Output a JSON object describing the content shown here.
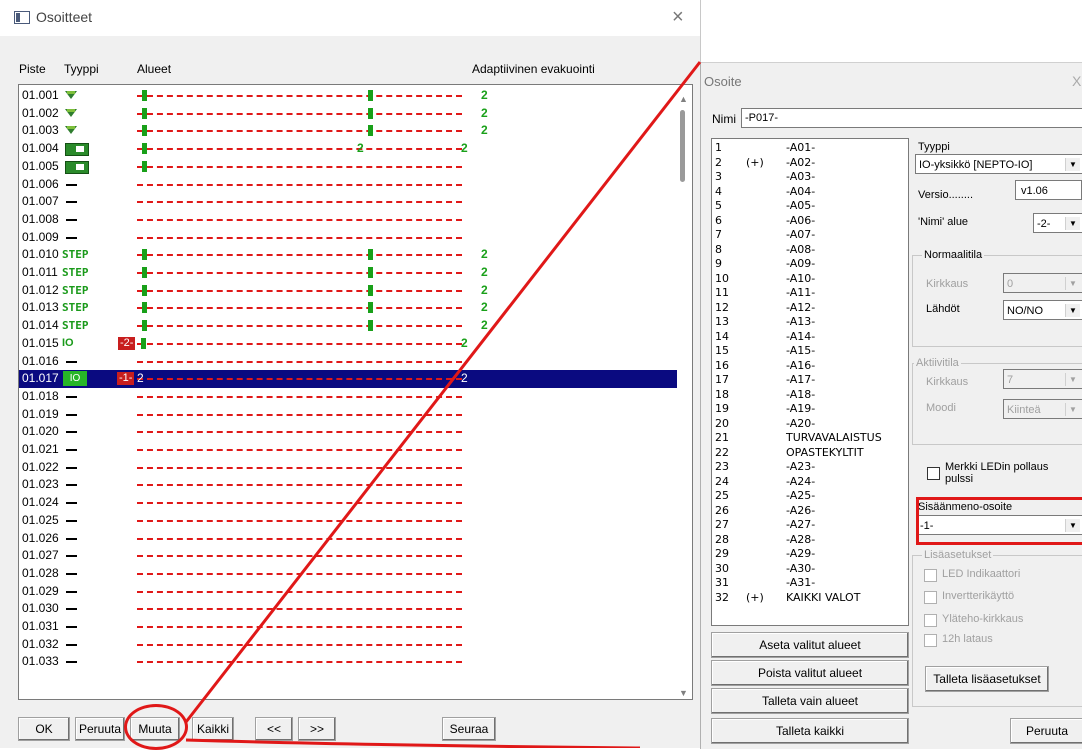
{
  "main_window": {
    "title": "Osoitteet",
    "close_symbol": "×",
    "columns": {
      "piste": "Piste",
      "tyyppi": "Tyyppi",
      "alueet": "Alueet",
      "adaptive": "Adaptiivinen evakuointi"
    },
    "rows": [
      {
        "id": "01.001",
        "type": "shield-icon",
        "areas": [
          "1",
          "1",
          "2"
        ]
      },
      {
        "id": "01.002",
        "type": "shield-icon",
        "areas": [
          "1",
          "1",
          "2"
        ]
      },
      {
        "id": "01.003",
        "type": "shield-icon",
        "areas": [
          "1",
          "1",
          "2"
        ]
      },
      {
        "id": "01.004",
        "type": "board-icon",
        "areas": [
          "1",
          "2",
          "2"
        ]
      },
      {
        "id": "01.005",
        "type": "board-icon",
        "areas": [
          "1"
        ]
      },
      {
        "id": "01.006",
        "type": "dash",
        "areas": []
      },
      {
        "id": "01.007",
        "type": "dash",
        "areas": []
      },
      {
        "id": "01.008",
        "type": "dash",
        "areas": []
      },
      {
        "id": "01.009",
        "type": "dash",
        "areas": []
      },
      {
        "id": "01.010",
        "type": "STEP",
        "areas": [
          "1",
          "1",
          "2"
        ]
      },
      {
        "id": "01.011",
        "type": "STEP",
        "areas": [
          "1",
          "1",
          "2"
        ]
      },
      {
        "id": "01.012",
        "type": "STEP",
        "areas": [
          "1",
          "1",
          "2"
        ]
      },
      {
        "id": "01.013",
        "type": "STEP",
        "areas": [
          "1",
          "1",
          "2"
        ]
      },
      {
        "id": "01.014",
        "type": "STEP",
        "areas": [
          "1",
          "1",
          "2"
        ]
      },
      {
        "id": "01.015",
        "type": "IO",
        "tag": "-2-",
        "areas": [
          "1",
          "2"
        ]
      },
      {
        "id": "01.016",
        "type": "dash",
        "areas": []
      },
      {
        "id": "01.017",
        "type": "IO-selected",
        "tag": "-1-",
        "areas": [
          "2",
          "2"
        ]
      },
      {
        "id": "01.018",
        "type": "dash",
        "areas": []
      },
      {
        "id": "01.019",
        "type": "dash",
        "areas": []
      },
      {
        "id": "01.020",
        "type": "dash",
        "areas": []
      },
      {
        "id": "01.021",
        "type": "dash",
        "areas": []
      },
      {
        "id": "01.022",
        "type": "dash",
        "areas": []
      },
      {
        "id": "01.023",
        "type": "dash",
        "areas": []
      },
      {
        "id": "01.024",
        "type": "dash",
        "areas": []
      },
      {
        "id": "01.025",
        "type": "dash",
        "areas": []
      },
      {
        "id": "01.026",
        "type": "dash",
        "areas": []
      },
      {
        "id": "01.027",
        "type": "dash",
        "areas": []
      },
      {
        "id": "01.028",
        "type": "dash",
        "areas": []
      },
      {
        "id": "01.029",
        "type": "dash",
        "areas": []
      },
      {
        "id": "01.030",
        "type": "dash",
        "areas": []
      },
      {
        "id": "01.031",
        "type": "dash",
        "areas": []
      },
      {
        "id": "01.032",
        "type": "dash",
        "areas": []
      },
      {
        "id": "01.033",
        "type": "dash",
        "areas": []
      }
    ],
    "buttons": {
      "ok": "OK",
      "peruuta": "Peruuta",
      "muuta": "Muuta",
      "kaikki": "Kaikki",
      "prev": "<<",
      "next": ">>",
      "seuraa": "Seuraa"
    },
    "step_label": "STEP",
    "io_label": "IO"
  },
  "dialog": {
    "title": "Osoite",
    "close_symbol": "X",
    "nimi_label": "Nimi",
    "nimi_value": "-P017-",
    "areas": [
      {
        "num": "1",
        "flag": "",
        "name": "-A01-"
      },
      {
        "num": "2",
        "flag": "(+)",
        "name": "-A02-"
      },
      {
        "num": "3",
        "flag": "",
        "name": "-A03-"
      },
      {
        "num": "4",
        "flag": "",
        "name": "-A04-"
      },
      {
        "num": "5",
        "flag": "",
        "name": "-A05-"
      },
      {
        "num": "6",
        "flag": "",
        "name": "-A06-"
      },
      {
        "num": "7",
        "flag": "",
        "name": "-A07-"
      },
      {
        "num": "8",
        "flag": "",
        "name": "-A08-"
      },
      {
        "num": "9",
        "flag": "",
        "name": "-A09-"
      },
      {
        "num": "10",
        "flag": "",
        "name": "-A10-"
      },
      {
        "num": "11",
        "flag": "",
        "name": "-A11-"
      },
      {
        "num": "12",
        "flag": "",
        "name": "-A12-"
      },
      {
        "num": "13",
        "flag": "",
        "name": "-A13-"
      },
      {
        "num": "14",
        "flag": "",
        "name": "-A14-"
      },
      {
        "num": "15",
        "flag": "",
        "name": "-A15-"
      },
      {
        "num": "16",
        "flag": "",
        "name": "-A16-"
      },
      {
        "num": "17",
        "flag": "",
        "name": "-A17-"
      },
      {
        "num": "18",
        "flag": "",
        "name": "-A18-"
      },
      {
        "num": "19",
        "flag": "",
        "name": "-A19-"
      },
      {
        "num": "20",
        "flag": "",
        "name": "-A20-"
      },
      {
        "num": "21",
        "flag": "",
        "name": "TURVAVALAISTUS"
      },
      {
        "num": "22",
        "flag": "",
        "name": "OPASTEKYLTIT"
      },
      {
        "num": "23",
        "flag": "",
        "name": "-A23-"
      },
      {
        "num": "24",
        "flag": "",
        "name": "-A24-"
      },
      {
        "num": "25",
        "flag": "",
        "name": "-A25-"
      },
      {
        "num": "26",
        "flag": "",
        "name": "-A26-"
      },
      {
        "num": "27",
        "flag": "",
        "name": "-A27-"
      },
      {
        "num": "28",
        "flag": "",
        "name": "-A28-"
      },
      {
        "num": "29",
        "flag": "",
        "name": "-A29-"
      },
      {
        "num": "30",
        "flag": "",
        "name": "-A30-"
      },
      {
        "num": "31",
        "flag": "",
        "name": "-A31-"
      },
      {
        "num": "32",
        "flag": "(+)",
        "name": "KAIKKI VALOT"
      }
    ],
    "tyyppi_label": "Tyyppi",
    "tyyppi_value": "IO-yksikkö [NEPTO-IO]",
    "versio_label": "Versio........",
    "versio_value": "v1.06",
    "nimi_alue_label": "'Nimi' alue",
    "nimi_alue_value": "-2-",
    "normaalitila": {
      "title": "Normaalitila",
      "kirkkaus_label": "Kirkkaus",
      "kirkkaus_value": "0",
      "lahdot_label": "Lähdöt",
      "lahdot_value": "NO/NO"
    },
    "aktiivitila": {
      "title": "Aktiivitila",
      "kirkkaus_label": "Kirkkaus",
      "kirkkaus_value": "7",
      "moodi_label": "Moodi",
      "moodi_value": "Kiinteä"
    },
    "merkki_led": "Merkki LEDin pollaus pulssi",
    "sisaan_label": "Sisäänmeno-osoite",
    "sisaan_value": "-1-",
    "lisaasetukset": {
      "title": "Lisäasetukset",
      "led": "LED Indikaattori",
      "invertteri": "Invertterikäyttö",
      "ylateho": "Yläteho-kirkkaus",
      "lataus": "12h lataus"
    },
    "buttons": {
      "aseta": "Aseta valitut alueet",
      "poista": "Poista valitut alueet",
      "talleta_alueet": "Talleta vain alueet",
      "talleta_kaikki": "Talleta kaikki",
      "talleta_lisa": "Talleta lisäasetukset",
      "peruuta": "Peruuta"
    }
  },
  "colors": {
    "selection": "#0a0a80",
    "area_green": "#19a019",
    "dash_red": "#e01818",
    "annotation_red": "#e01818"
  }
}
